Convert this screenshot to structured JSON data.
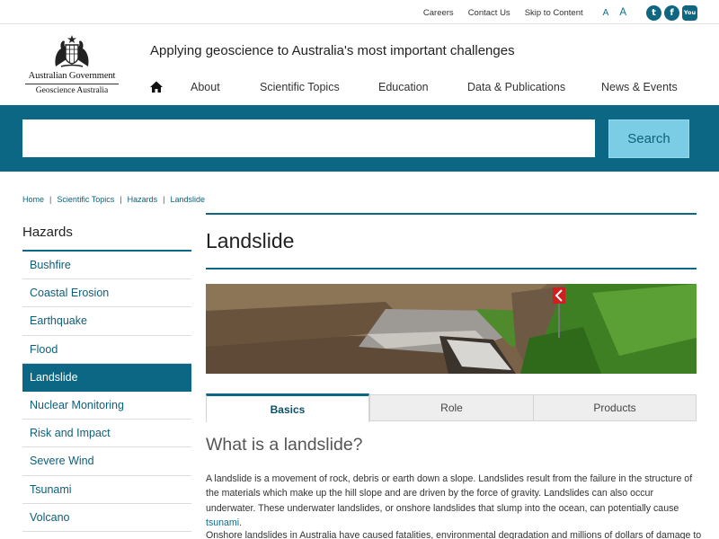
{
  "utility": {
    "links": [
      "Careers",
      "Contact Us",
      "Skip to Content"
    ],
    "font_small": "A",
    "font_large": "A",
    "social": [
      "twitter-icon",
      "facebook-icon",
      "youtube-icon"
    ]
  },
  "header": {
    "logo_name": "Australian Government",
    "logo_sub": "Geoscience Australia",
    "tagline": "Applying geoscience to Australia's most important challenges"
  },
  "nav": {
    "items": [
      "About",
      "Scientific Topics",
      "Education",
      "Data & Publications",
      "News & Events"
    ]
  },
  "search": {
    "placeholder": "",
    "button_label": "Search"
  },
  "breadcrumb": [
    "Home",
    "Scientific Topics",
    "Hazards",
    "Landslide"
  ],
  "sidebar": {
    "title": "Hazards",
    "items": [
      "Bushfire",
      "Coastal Erosion",
      "Earthquake",
      "Flood",
      "Landslide",
      "Nuclear Monitoring",
      "Risk and Impact",
      "Severe Wind",
      "Tsunami",
      "Volcano"
    ],
    "active": "Landslide"
  },
  "main": {
    "title": "Landslide",
    "tabs": [
      "Basics",
      "Role",
      "Products"
    ],
    "active_tab": "Basics",
    "section_heading": "What is a landslide?",
    "para1_text": "A landslide is a movement of rock, debris or earth down a slope. Landslides result from the failure in the structure of the materials which make up the hill slope and are driven by the force of gravity. Landslides can also occur underwater. These underwater landslides, or onshore landslides that slump into the ocean, can potentially cause ",
    "para1_link": "tsunami",
    "para1_end": ".",
    "para2_text": "Onshore landslides in Australia have caused fatalities, environmental degradation and millions of dollars of damage to"
  },
  "colors": {
    "brand": "#0c6785",
    "search_button": "#7bcde5",
    "link": "#0c5f7a"
  }
}
